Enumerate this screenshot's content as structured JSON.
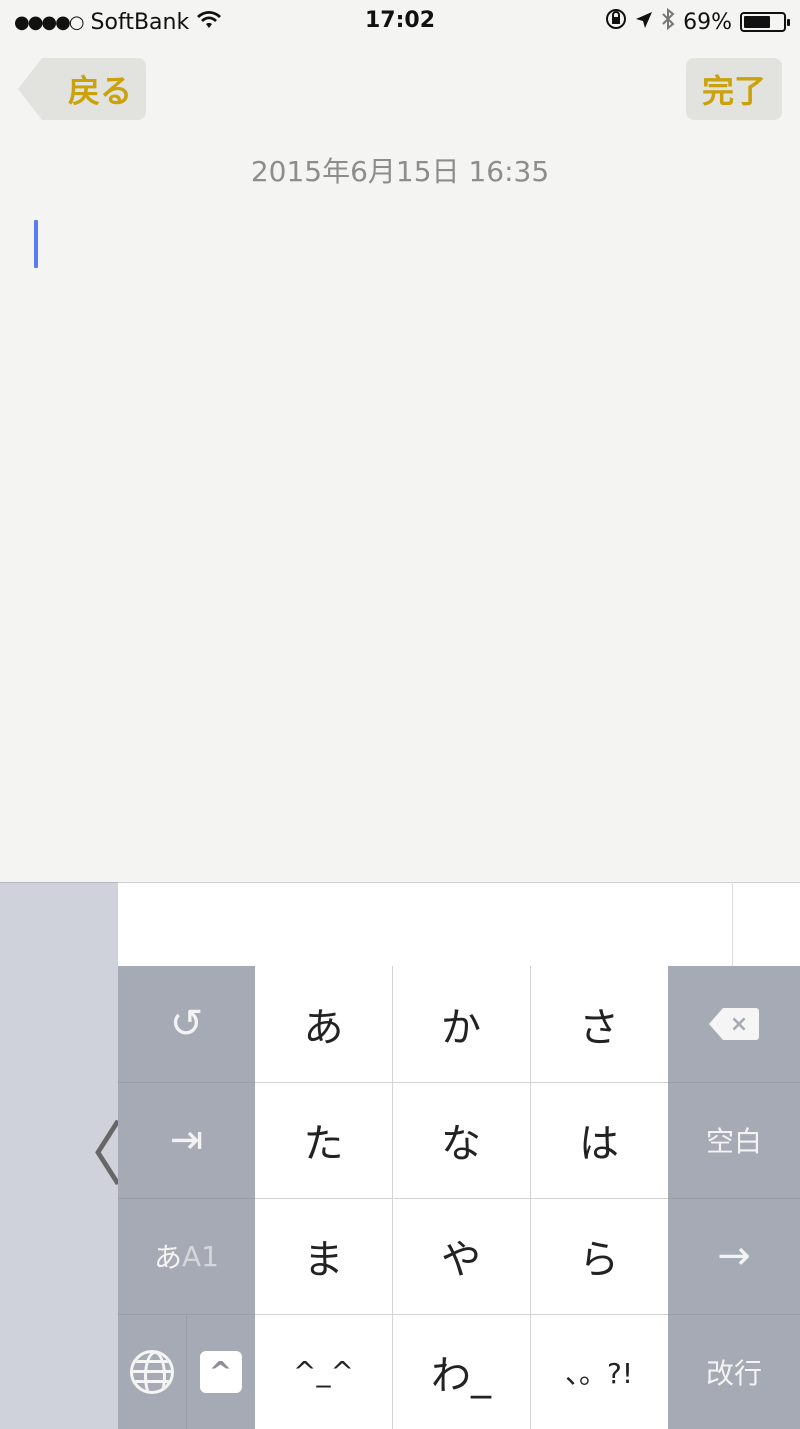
{
  "status_bar": {
    "signal": "●●●●○",
    "carrier": "SoftBank",
    "time": "17:02",
    "battery_percent_label": "69%",
    "battery_level": 0.69
  },
  "nav": {
    "back_label": "戻る",
    "done_label": "完了"
  },
  "note": {
    "date": "2015年6月15日 16:35",
    "body_text": ""
  },
  "keyboard": {
    "collapse_glyph": "〈",
    "undo_glyph": "↺",
    "switch_glyph": "⇥",
    "mode_label_primary": "あ",
    "mode_label_secondary": "A1",
    "caret_glyph": "^",
    "delete_glyph": "×",
    "space_label": "空白",
    "arrow_label": "→",
    "return_label": "改行",
    "kana_rows": [
      [
        "あ",
        "か",
        "さ"
      ],
      [
        "た",
        "な",
        "は"
      ],
      [
        "ま",
        "や",
        "ら"
      ],
      [
        "^_^",
        "わ_",
        "、。?!"
      ]
    ]
  },
  "colors": {
    "accent": "#c9a20c",
    "cursor": "#5b7cf0",
    "key_gray": "#a6aab4"
  }
}
